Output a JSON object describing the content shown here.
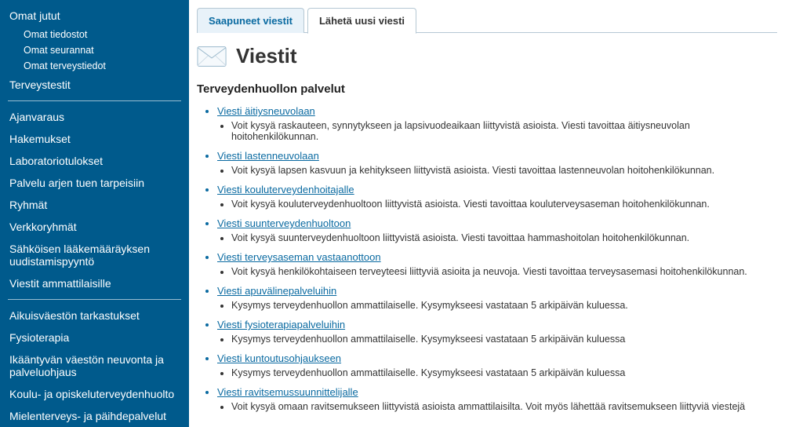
{
  "sidebar": {
    "group1": {
      "top": "Omat jutut",
      "subs": [
        "Omat tiedostot",
        "Omat seurannat",
        "Omat terveystiedot"
      ],
      "after": "Terveystestit"
    },
    "group2": [
      "Ajanvaraus",
      "Hakemukset",
      "Laboratoriotulokset",
      "Palvelu arjen tuen tarpeisiin",
      "Ryhmät",
      "Verkkoryhmät",
      "Sähköisen lääkemääräyksen uudistamispyyntö",
      "Viestit ammattilaisille"
    ],
    "group3": [
      "Aikuisväestön tarkastukset",
      "Fysioterapia",
      "Ikääntyvän väestön neuvonta ja palveluohjaus",
      "Koulu- ja opiskeluterveydenhuolto",
      "Mielenterveys- ja päihdepalvelut"
    ]
  },
  "tabs": {
    "inbox": "Saapuneet viestit",
    "compose": "Lähetä uusi viesti"
  },
  "page_title": "Viestit",
  "section_heading": "Terveydenhuollon palvelut",
  "messages": [
    {
      "link": "Viesti äitiysneuvolaan",
      "desc": "Voit kysyä raskauteen, synnytykseen ja lapsivuodeaikaan liittyvistä asioista. Viesti tavoittaa äitiysneuvolan hoitohenkilökunnan."
    },
    {
      "link": "Viesti lastenneuvolaan",
      "desc": "Voit kysyä lapsen kasvuun ja kehitykseen liittyvistä asioista. Viesti tavoittaa lastenneuvolan hoitohenkilökunnan."
    },
    {
      "link": "Viesti kouluterveydenhoitajalle",
      "desc": "Voit kysyä kouluterveydenhuoltoon liittyvistä asioista. Viesti tavoittaa kouluterveysaseman hoitohenkilökunnan."
    },
    {
      "link": "Viesti suunterveydenhuoltoon",
      "desc": "Voit kysyä suunterveydenhuoltoon liittyvistä asioista. Viesti tavoittaa hammashoitolan hoitohenkilökunnan."
    },
    {
      "link": "Viesti terveysaseman vastaanottoon",
      "desc": "Voit kysyä henkilökohtaiseen terveyteesi liittyviä asioita ja neuvoja. Viesti tavoittaa terveysasemasi hoitohenkilökunnan."
    },
    {
      "link": "Viesti apuvälinepalveluihin",
      "desc": "Kysymys terveydenhuollon ammattilaiselle. Kysymykseesi vastataan 5 arkipäivän kuluessa."
    },
    {
      "link": "Viesti fysioterapiapalveluihin",
      "desc": "Kysymys terveydenhuollon ammattilaiselle. Kysymykseesi vastataan 5 arkipäivän kuluessa"
    },
    {
      "link": "Viesti kuntoutusohjaukseen",
      "desc": "Kysymys terveydenhuollon ammattilaiselle. Kysymykseesi vastataan 5 arkipäivän kuluessa"
    },
    {
      "link": "Viesti ravitsemussuunnittelijalle",
      "desc": "Voit kysyä omaan ravitsemukseen liittyvistä asioista ammattilaisilta. Voit myös lähettää ravitsemukseen liittyviä viestejä"
    }
  ]
}
